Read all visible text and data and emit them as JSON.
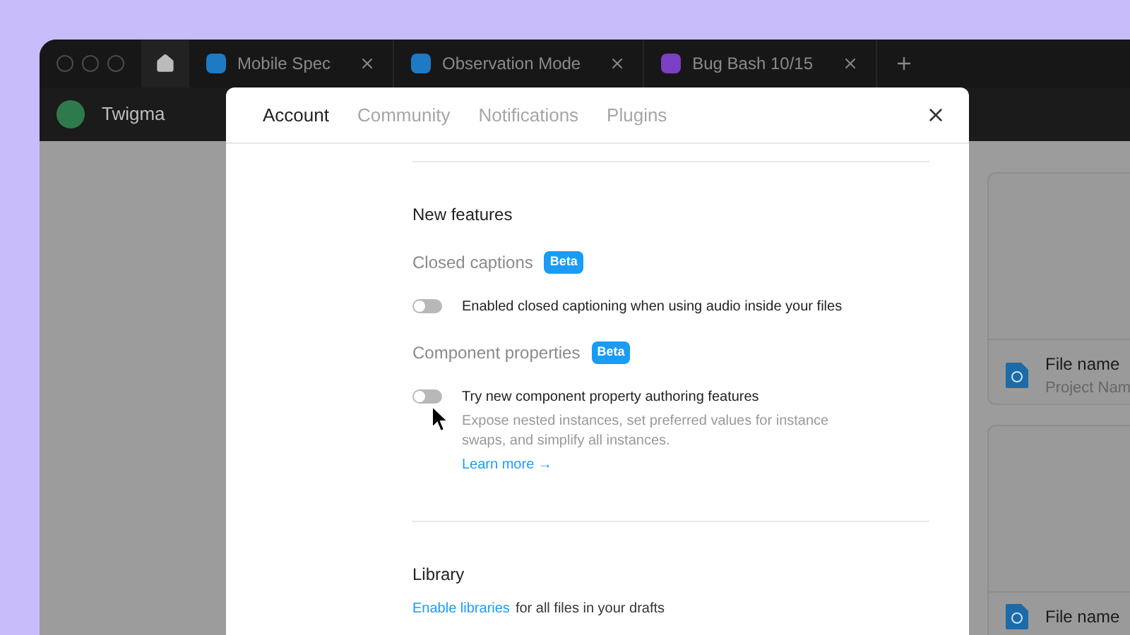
{
  "browser_tabs": [
    {
      "label": "Mobile Spec",
      "color": "#1e7ac4"
    },
    {
      "label": "Observation Mode",
      "color": "#1e7ac4"
    },
    {
      "label": "Bug Bash 10/15",
      "color": "#7b3fc4"
    }
  ],
  "app": {
    "name": "Twigma"
  },
  "files": [
    {
      "name": "File name",
      "project": "Project Nam"
    },
    {
      "name": "File name"
    }
  ],
  "modal": {
    "tabs": [
      {
        "label": "Account",
        "selected": true
      },
      {
        "label": "Community",
        "selected": false
      },
      {
        "label": "Notifications",
        "selected": false
      },
      {
        "label": "Plugins",
        "selected": false
      }
    ],
    "section_title": "New features",
    "features": [
      {
        "title": "Closed captions",
        "badge": "Beta",
        "toggle_label": "Enabled closed captioning when using audio inside your files",
        "on": false
      },
      {
        "title": "Component properties",
        "badge": "Beta",
        "toggle_label": "Try new component property authoring features",
        "on": false,
        "description": "Expose nested instances, set preferred values for instance swaps, and simplify all instances.",
        "link": "Learn more →"
      }
    ],
    "library": {
      "title": "Library",
      "link": "Enable libraries",
      "text": "for all files in your drafts"
    }
  }
}
